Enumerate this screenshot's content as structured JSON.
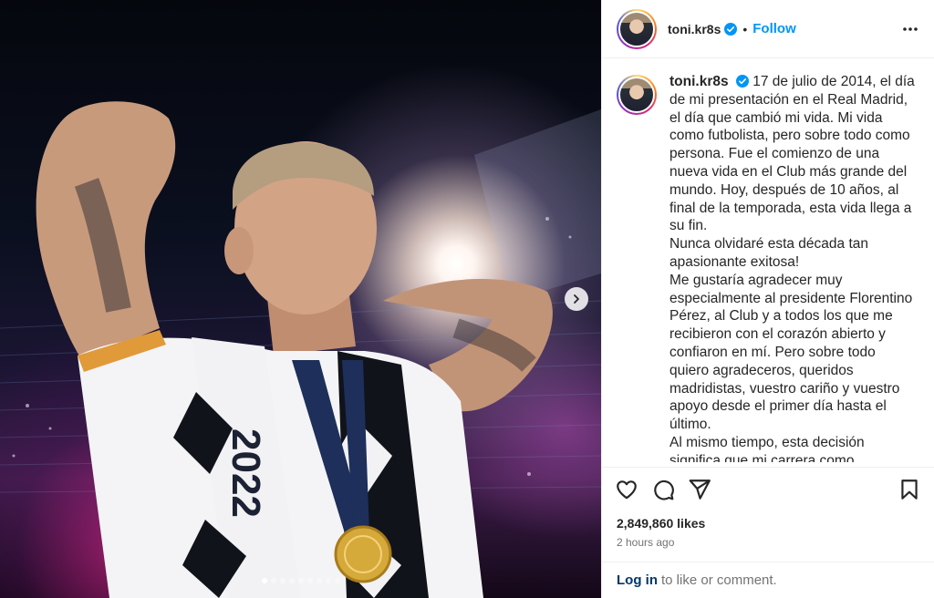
{
  "header": {
    "username": "toni.kr8s",
    "separator": "•",
    "follow_label": "Follow"
  },
  "caption": {
    "username": "toni.kr8s",
    "lines": [
      "17 de julio de 2014, el día de mi presentación en el Real Madrid, el día que cambió mi vida. Mi vida como futbolista, pero sobre todo como persona. Fue el comienzo de una nueva vida en el Club más grande del mundo. Hoy, después de 10 años, al final de la temporada, esta vida llega a su fin.",
      "Nunca olvidaré esta década tan apasionante exitosa!",
      "Me gustaría agradecer muy especialmente al presidente Florentino Pérez, al Club y a todos los que me recibieron con el corazón abierto y confiaron en mí. Pero sobre todo quiero agradeceros, queridos madridistas, vuestro cariño y vuestro apoyo desde el primer día hasta el último.",
      "Al mismo tiempo, esta decisión significa que mi carrera como"
    ]
  },
  "stats": {
    "likes": "2,849,860 likes",
    "time": "2 hours ago"
  },
  "login": {
    "link": "Log in",
    "rest": "to like or comment."
  },
  "media": {
    "scarf_text": "2022",
    "carousel_dot_count": 9,
    "active_dot": 0
  },
  "icons": {
    "verified": "verified-badge-icon",
    "more": "more-horizontal-icon",
    "like": "heart-icon",
    "comment": "comment-icon",
    "share": "paper-plane-icon",
    "save": "bookmark-icon",
    "next": "chevron-right-icon"
  },
  "colors": {
    "accent": "#0095f6",
    "verified": "#0095f6",
    "link": "#00376b"
  }
}
